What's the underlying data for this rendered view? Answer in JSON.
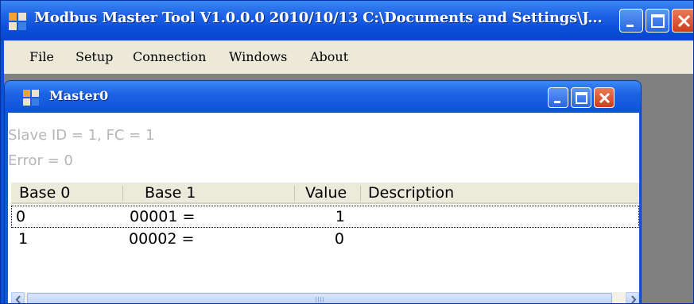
{
  "app": {
    "title": "Modbus Master Tool V1.0.0.0  2010/10/13  C:\\Documents and Settings\\J...",
    "menu": [
      "File",
      "Setup",
      "Connection",
      "Windows",
      "About"
    ]
  },
  "child": {
    "title": "Master0",
    "status_line1": "Slave ID = 1, FC = 1",
    "status_line2": "Error = 0",
    "columns": [
      "Base 0",
      "Base 1",
      "Value",
      "Description"
    ],
    "rows": [
      {
        "base0": "0",
        "base1": "00001  =",
        "value": "1",
        "description": ""
      },
      {
        "base0": "1",
        "base1": "00002  =",
        "value": "0",
        "description": ""
      }
    ]
  },
  "colors": {
    "titlebar": "#0a50d8",
    "menubar": "#ece9d8",
    "mdi_background": "#808080",
    "status_text": "#b6b6b6",
    "close_button": "#cf3d1c"
  },
  "icons": [
    "app-icon",
    "minimize-icon",
    "maximize-icon",
    "close-icon",
    "scroll-left-icon",
    "scroll-right-icon"
  ]
}
